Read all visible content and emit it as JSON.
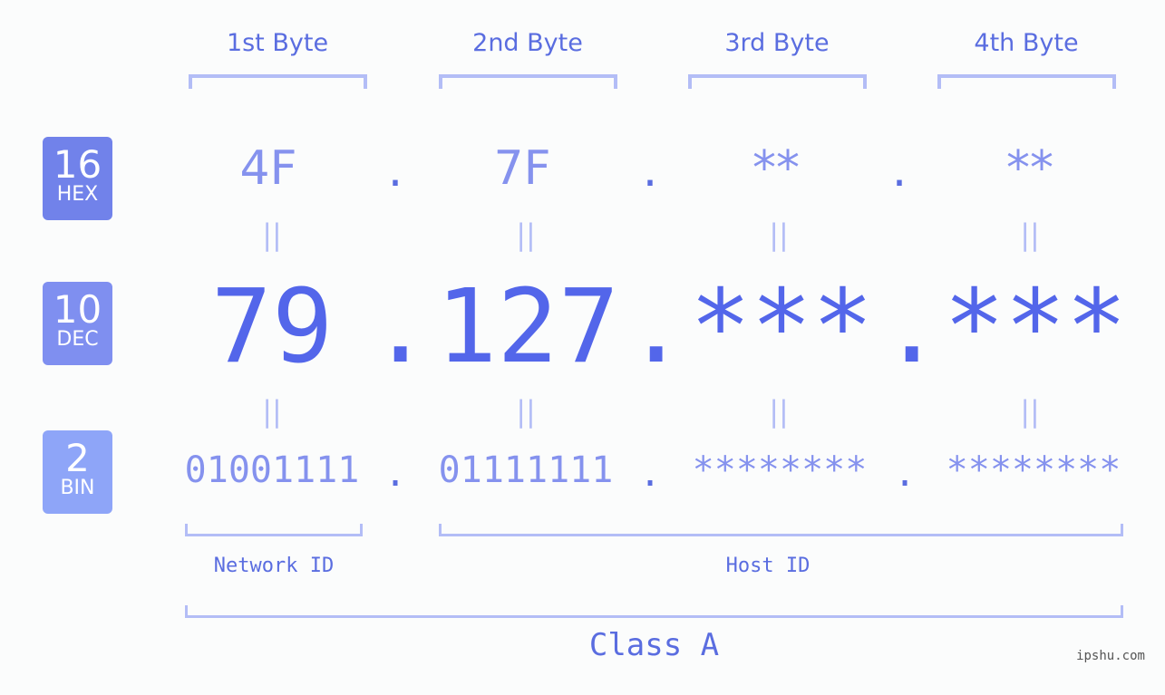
{
  "byte_headers": [
    "1st Byte",
    "2nd Byte",
    "3rd Byte",
    "4th Byte"
  ],
  "badges": {
    "hex": {
      "number": "16",
      "label": "HEX",
      "color": "#7182ea"
    },
    "dec": {
      "number": "10",
      "label": "DEC",
      "color": "#7f8ff0"
    },
    "bin": {
      "number": "2",
      "label": "BIN",
      "color": "#8ea5f8"
    }
  },
  "hex": [
    "4F",
    "7F",
    "**",
    "**"
  ],
  "dec": [
    "79",
    "127",
    "***",
    "***"
  ],
  "bin": [
    "01001111",
    "01111111",
    "********",
    "********"
  ],
  "separator": ".",
  "equals": "||",
  "parts": {
    "network": "Network ID",
    "host": "Host ID"
  },
  "class_label": "Class A",
  "watermark": "ipshu.com",
  "colors": {
    "accent": "#5366ea",
    "light": "#8592ee",
    "bracket": "#b3bdf6"
  }
}
